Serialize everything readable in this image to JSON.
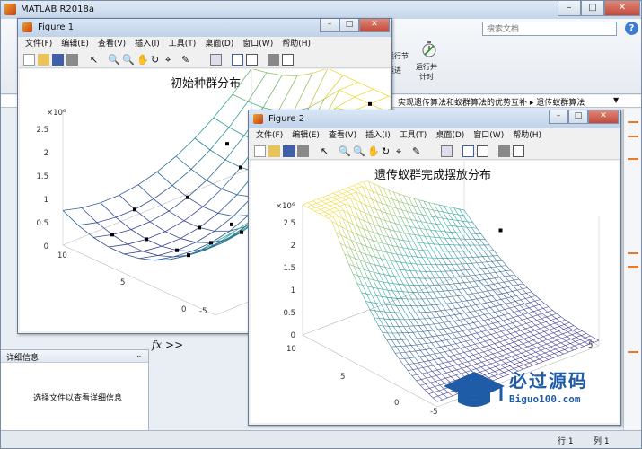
{
  "main_window": {
    "title": "MATLAB R2018a",
    "search_placeholder": "搜索文档",
    "ribbon_label_1": "运行节",
    "ribbon_label_2": "运行并\n计时",
    "ribbon_label_3": "运进",
    "path": "实现遗传算法和蚁群算法的优势互补 ▸ 遗传蚁群算法",
    "detail_header": "详细信息",
    "detail_hint": "选择文件以查看详细信息",
    "fx": "fx >>",
    "status_row_label": "行 1",
    "status_col_label": "列 1"
  },
  "figure1": {
    "title": "Figure 1",
    "menus": [
      "文件(F)",
      "编辑(E)",
      "查看(V)",
      "插入(I)",
      "工具(T)",
      "桌面(D)",
      "窗口(W)",
      "帮助(H)"
    ],
    "plot_title": "初始种群分布",
    "z_exponent": "×10⁶",
    "z_ticks": [
      "2.5",
      "2",
      "1.5",
      "1",
      "0.5",
      "0"
    ],
    "y_ticks": [
      "10",
      "5",
      "0"
    ],
    "x_ticks": [
      "-5"
    ]
  },
  "figure2": {
    "title": "Figure 2",
    "menus": [
      "文件(F)",
      "编辑(E)",
      "查看(V)",
      "插入(I)",
      "工具(T)",
      "桌面(D)",
      "窗口(W)",
      "帮助(H)"
    ],
    "plot_title": "遗传蚁群完成摆放分布",
    "z_exponent": "×10⁶",
    "z_ticks": [
      "2.5",
      "2",
      "1.5",
      "1",
      "0.5",
      "0"
    ],
    "y_ticks": [
      "10",
      "5",
      "0",
      "-5"
    ],
    "x_ticks": [
      "5"
    ]
  },
  "watermark": {
    "cn": "必过源码",
    "en": "Biguo100.com"
  },
  "colors": {
    "surface_low": "#3b2a8c",
    "surface_mid": "#21a19a",
    "surface_high": "#f2d93a"
  }
}
